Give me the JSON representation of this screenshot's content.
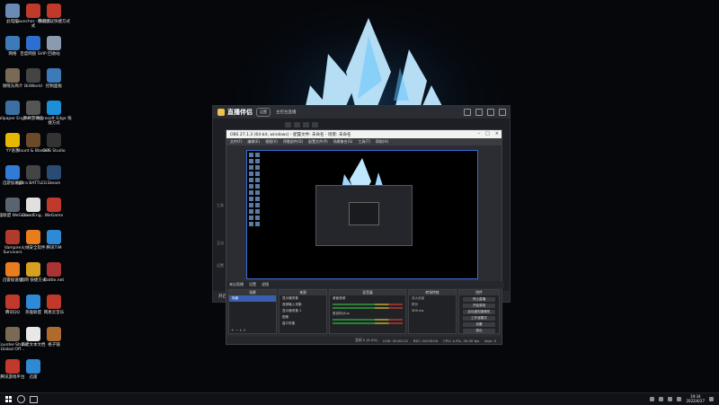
{
  "desktop_icons": [
    {
      "label": "此电脑",
      "color": "#6a8bb5"
    },
    {
      "label": "Launcher - 快捷方式",
      "color": "#c0392b"
    },
    {
      "label": "腾讯会议快捷方式",
      "color": "#c0392b"
    },
    {
      "label": "网络",
      "color": "#3d7ab8"
    },
    {
      "label": "百度网盘 SVIP",
      "color": "#2d6fd1"
    },
    {
      "label": "回收站",
      "color": "#8a9bb0"
    },
    {
      "label": "谢晓东简介",
      "color": "#7a6a55"
    },
    {
      "label": "BiliWorld",
      "color": "#444"
    },
    {
      "label": "控制面板",
      "color": "#3d7ab8"
    },
    {
      "label": "Wallpaper Engine",
      "color": "#3c6fa3"
    },
    {
      "label": "原神游戏盒",
      "color": "#555"
    },
    {
      "label": "Microsoft Edge 快捷方式",
      "color": "#1e8fd6"
    },
    {
      "label": "YY语音",
      "color": "#e6b800"
    },
    {
      "label": "Mount & Blade II",
      "color": "#6b4a2a"
    },
    {
      "label": "OBS Studio",
      "color": "#333"
    },
    {
      "label": "迅游加速器",
      "color": "#2f7bd6"
    },
    {
      "label": "Hydra BATTLEG...",
      "color": "#444"
    },
    {
      "label": "Steam",
      "color": "#2a4b73"
    },
    {
      "label": "英雄联盟 WeGame",
      "color": "#5a6470"
    },
    {
      "label": "CloudEng...",
      "color": "#e0e0e0"
    },
    {
      "label": "WeGame",
      "color": "#c0392b"
    },
    {
      "label": "Vampire Survivors",
      "color": "#b03a2e"
    },
    {
      "label": "火绒安全软件",
      "color": "#e87c1e"
    },
    {
      "label": "腾讯TIM",
      "color": "#2f8ad6"
    },
    {
      "label": "迅雷极速版",
      "color": "#e87c1e"
    },
    {
      "label": "战网 快捷方式",
      "color": "#d6a11e"
    },
    {
      "label": "Battle.net",
      "color": "#a33"
    },
    {
      "label": "腾讯QQ",
      "color": "#c0392b"
    },
    {
      "label": "英雄联盟",
      "color": "#2f8ad6"
    },
    {
      "label": "网易云音乐",
      "color": "#c0392b"
    },
    {
      "label": "Counter-Strike Global Off...",
      "color": "#7a6a55"
    },
    {
      "label": "新建文本文档",
      "color": "#e8e8e8"
    },
    {
      "label": "格子铺",
      "color": "#b06a2e"
    },
    {
      "label": "腾讯游戏平台",
      "color": "#c0392b"
    },
    {
      "label": "迅雷",
      "color": "#2f8ad6"
    }
  ],
  "host_app": {
    "title": "直播伴侣",
    "pill": "设置",
    "tab_label": "主控台直播",
    "side_labels": [
      "工具",
      "互动",
      "设置"
    ],
    "footer_label": "开启直播"
  },
  "obs": {
    "title": "OBS 27.1.3 (64-bit, windows) - 配置文件: 未命名 - 场景: 未命名",
    "menu": [
      "文件(F)",
      "编辑(E)",
      "视图(V)",
      "停靠部件(D)",
      "配置文件(P)",
      "场景集合(S)",
      "工具(T)",
      "帮助(H)"
    ],
    "window_controls": [
      "–",
      "□",
      "×"
    ],
    "scene_strip": [
      "来自直播",
      "设置",
      "滤镜"
    ],
    "docks": {
      "scenes": {
        "title": "场景",
        "items": [
          "场景"
        ]
      },
      "sources": {
        "title": "来源",
        "items": [
          "显示器采集",
          "音频输入采集",
          "显示器采集 2",
          "图像",
          "窗口采集"
        ]
      },
      "mixer": {
        "title": "混音器",
        "tracks": [
          "桌面音频",
          "麦克风/Aux"
        ]
      },
      "transitions": {
        "title": "转场特效",
        "items": [
          "淡入淡出",
          "时长",
          "300 ms"
        ]
      },
      "controls": {
        "title": "控件",
        "buttons": [
          "停止直播",
          "开始录制",
          "启动虚拟摄像机",
          "工作室模式",
          "设置",
          "退出"
        ]
      }
    },
    "status": [
      "丢帧 0 (0.0%)",
      "LIVE: 00:00:12",
      "REC: 00:00:00",
      "CPU: 4.3%, 30.00 fps",
      "kb/s: 0"
    ]
  },
  "taskbar": {
    "clock_time": "19:34",
    "clock_date": "2022/4/27"
  }
}
